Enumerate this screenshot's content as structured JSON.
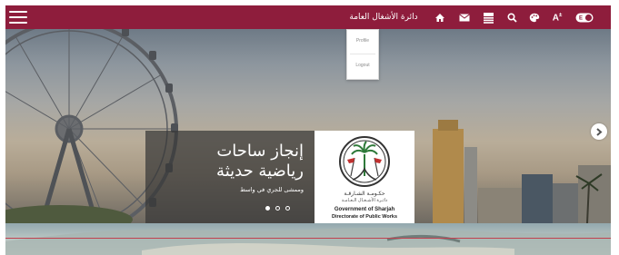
{
  "header": {
    "site_title": "دائرة الأشغال العامة",
    "font_size_label": "A",
    "font_size_sup": "±",
    "icons": [
      "menu-icon",
      "home-icon",
      "mail-icon",
      "sitemap-icon",
      "search-icon",
      "theme-palette-icon",
      "font-size-icon",
      "accessibility-toggle-icon"
    ]
  },
  "user_menu": {
    "items": [
      {
        "label": "Profile"
      },
      {
        "label": "Logout"
      }
    ]
  },
  "slider": {
    "caption_title_line1": "إنجاز ساحات",
    "caption_title_line2": "رياضية حديثة",
    "caption_subtitle": "وممشى للجري في واسط",
    "active_slide": 1,
    "slide_count": 3
  },
  "logo": {
    "arabic_line1": "حكـومـة الشـارقـة",
    "arabic_line2": "دائـرة الأشـغـال الـعـامـة",
    "english_line1": "Government of Sharjah",
    "english_line2": "Directorate of Public Works"
  },
  "colors": {
    "brand": "#8e1d3c",
    "accent_line": "#c0414f"
  }
}
